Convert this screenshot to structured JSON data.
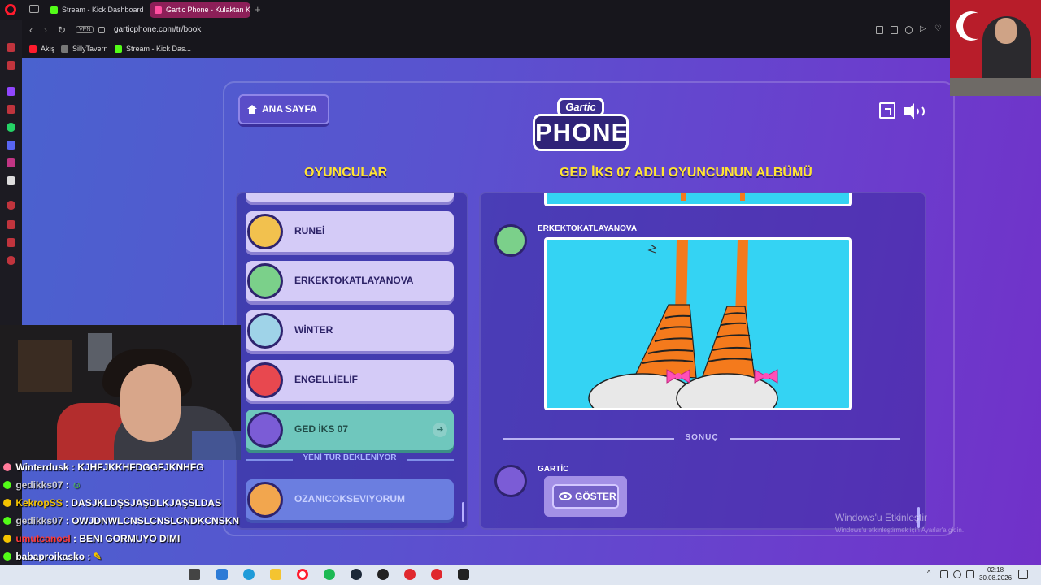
{
  "browser": {
    "tabs": [
      {
        "label": "Stream - Kick Dashboard",
        "color": "#53fc18"
      },
      {
        "label": "Gartic Phone - Kulaktan Ku",
        "color": "#ff4fa0"
      }
    ],
    "vpn_label": "VPN",
    "url": "garticphone.com/tr/book",
    "bookmarks": [
      {
        "label": "Akış",
        "color": "#ff1b2d"
      },
      {
        "label": "SillyTavern",
        "color": "#777777"
      },
      {
        "label": "Stream - Kick Das...",
        "color": "#53fc18"
      }
    ]
  },
  "game": {
    "home_button": "ANA SAYFA",
    "logo_top": "Gartic",
    "logo_main": "PHONE",
    "players_heading": "OYUNCULAR",
    "album_heading": "GED İKS 07 ADLI OYUNCUNUN ALBÜMÜ",
    "players": [
      {
        "name": "RUNEİ",
        "avatar_color": "#f2c14e"
      },
      {
        "name": "ERKEKTOKATLAYANOVA",
        "avatar_color": "#7bd08a"
      },
      {
        "name": "WİNTER",
        "avatar_color": "#9fd3e8"
      },
      {
        "name": "ENGELLİELİF",
        "avatar_color": "#e8484f"
      },
      {
        "name": "GED İKS 07",
        "avatar_color": "#7b5cd6"
      }
    ],
    "waiting_label": "YENİ TUR BEKLENİYOR",
    "waiting_player": {
      "name": "OZANICOKSEVIYORUM",
      "avatar_color": "#f2a64e"
    },
    "album": {
      "entry_author": "ERKEKTOKATLAYANOVA",
      "result_label": "SONUÇ",
      "result_author": "GARTİC",
      "show_button": "GÖSTER"
    }
  },
  "watermark": {
    "title": "Windows'u Etkinleştir",
    "subtitle": "Windows'u etkinleştirmek için Ayarlar'a gidin."
  },
  "chat": [
    {
      "user": "Winterdusk",
      "msg": "KJHFJKKHFDGGFJKNHFG",
      "badge_color": "#ff7a9c",
      "user_color": "#ffffff"
    },
    {
      "user": "gedikks07",
      "msg": "",
      "badge_color": "#53fc18",
      "user_color": "#c9c9d2"
    },
    {
      "user": "KekropSS",
      "msg": "DASJKLDŞSJAŞDLKJAŞSLDAS",
      "badge_color": "#f5c400",
      "user_color": "#f5c400"
    },
    {
      "user": "gedikks07",
      "msg": "OWJDNWLCNSLCNSLCNDKCNSKN",
      "badge_color": "#53fc18",
      "user_color": "#c9c9d2"
    },
    {
      "user": "umutcanosl",
      "msg": "BENI GORMUYO DIMI",
      "badge_color": "#f5c400",
      "user_color": "#ff3b3b"
    },
    {
      "user": "babaproikasko",
      "msg": "",
      "badge_color": "#53fc18",
      "user_color": "#ffffff"
    },
    {
      "user": "babaproikasko",
      "msg": "",
      "badge_color": "#f5c400",
      "user_color": "#ffffff"
    }
  ],
  "taskbar": {
    "time": "02:18",
    "date": "30.08.2026"
  }
}
